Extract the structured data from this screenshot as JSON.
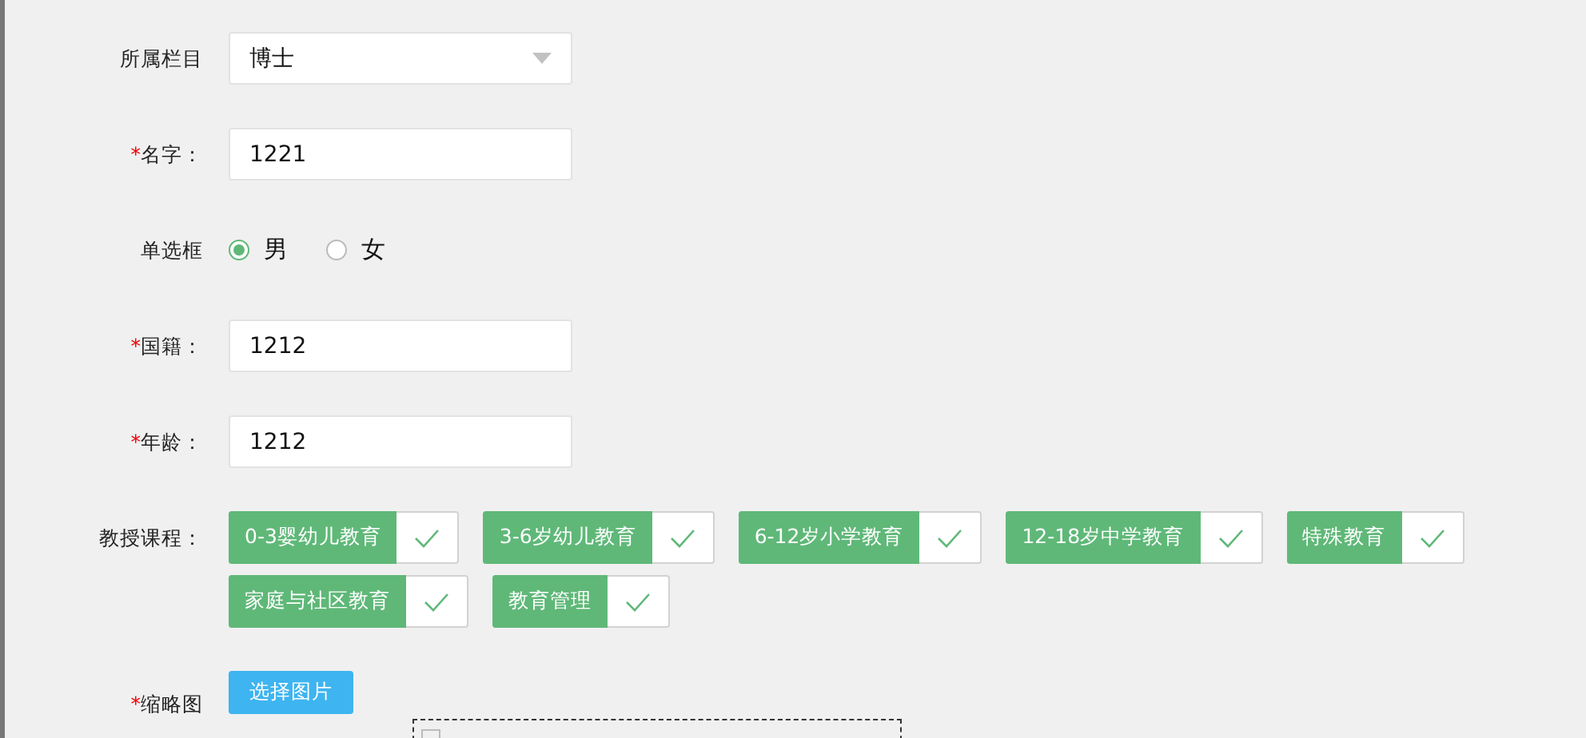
{
  "form": {
    "fields": [
      {
        "kind": "select",
        "label": "所属栏目",
        "value": "博士"
      },
      {
        "kind": "text",
        "label": "名字：",
        "mark": "*",
        "value": "1221"
      },
      {
        "kind": "radio",
        "label": "单选框",
        "options": [
          {
            "label": "男",
            "selected": true
          },
          {
            "label": "女",
            "selected": false
          }
        ]
      },
      {
        "kind": "text",
        "label": "国籍：",
        "mark": "*",
        "value": "1212"
      },
      {
        "kind": "text",
        "label": "年龄：",
        "mark": "*",
        "value": "1212"
      },
      {
        "kind": "checks",
        "label": "教授课程：",
        "options": [
          {
            "label": "0-3婴幼儿教育",
            "checked": true
          },
          {
            "label": "3-6岁幼儿教育",
            "checked": true
          },
          {
            "label": "6-12岁小学教育",
            "checked": true
          },
          {
            "label": "12-18岁中学教育",
            "checked": true
          },
          {
            "label": "特殊教育",
            "checked": true
          },
          {
            "label": "家庭与社区教育",
            "checked": true
          },
          {
            "label": "教育管理",
            "checked": true
          }
        ]
      },
      {
        "kind": "image",
        "label": "缩略图",
        "mark": "*",
        "button": "选择图片"
      }
    ]
  }
}
